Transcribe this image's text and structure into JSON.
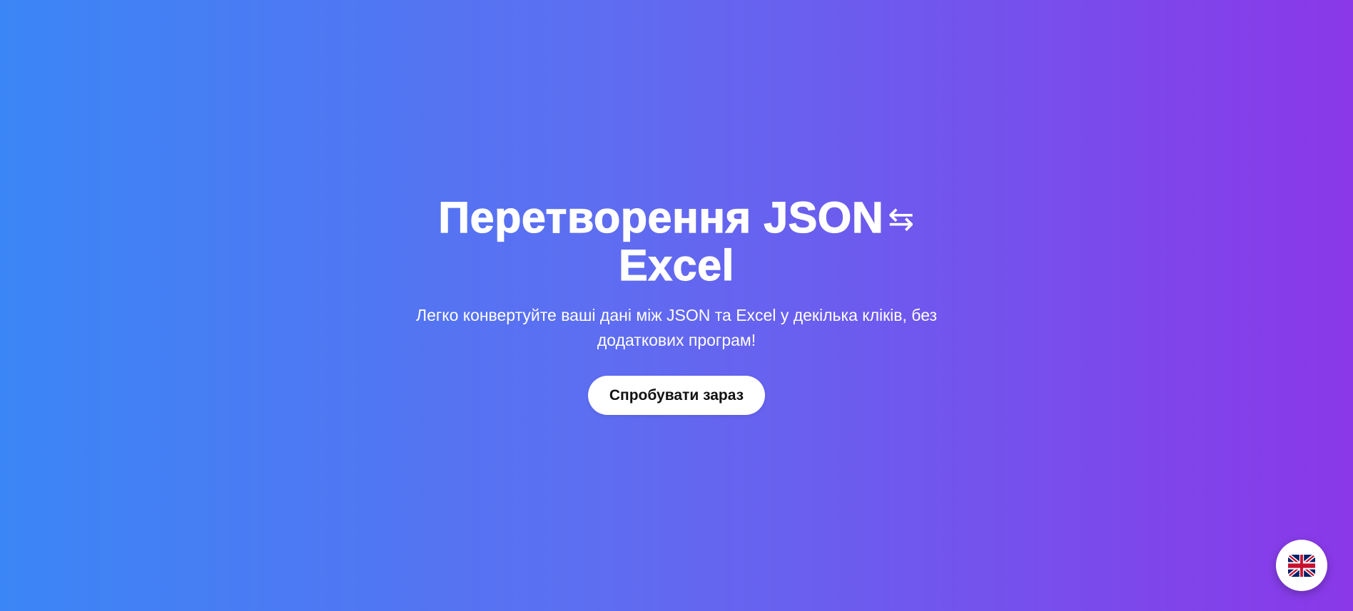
{
  "hero": {
    "title_main": "Перетворення JSON",
    "title_arrows": "⇆",
    "title_end": "Excel",
    "subtitle": "Легко конвертуйте ваші дані між JSON та Excel у декілька кліків, без додаткових програм!",
    "cta_label": "Спробувати зараз"
  },
  "language_switch": {
    "icon": "uk-flag-icon"
  },
  "colors": {
    "gradient_start": "#3b86f6",
    "gradient_end": "#8a38e8",
    "button_bg": "#ffffff",
    "text": "#ffffff"
  }
}
